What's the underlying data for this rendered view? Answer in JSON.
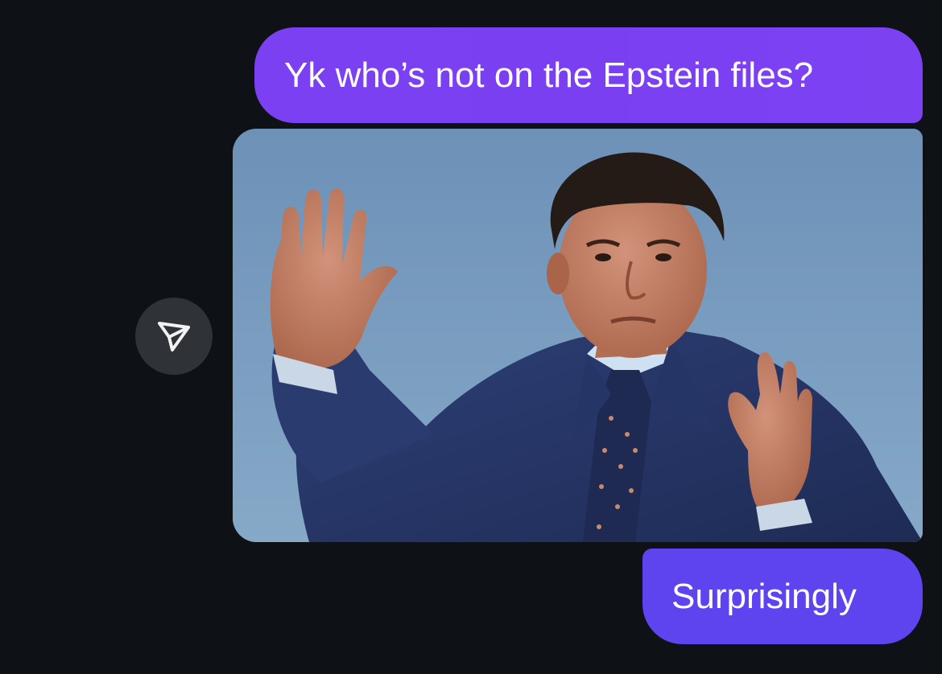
{
  "messages": [
    {
      "text": "Yk who’s not on the Epstein files?",
      "direction": "outgoing",
      "color": "#7b40f2"
    },
    {
      "media": {
        "icon": "photo",
        "subject": "man in navy suit raising both hands"
      }
    },
    {
      "text": "Surprisingly",
      "direction": "outgoing",
      "color": "#5e44ee"
    }
  ],
  "actions": {
    "forward_icon": "send-forward-icon"
  },
  "colors": {
    "background": "#0e1116",
    "action_button": "#2f3236"
  }
}
